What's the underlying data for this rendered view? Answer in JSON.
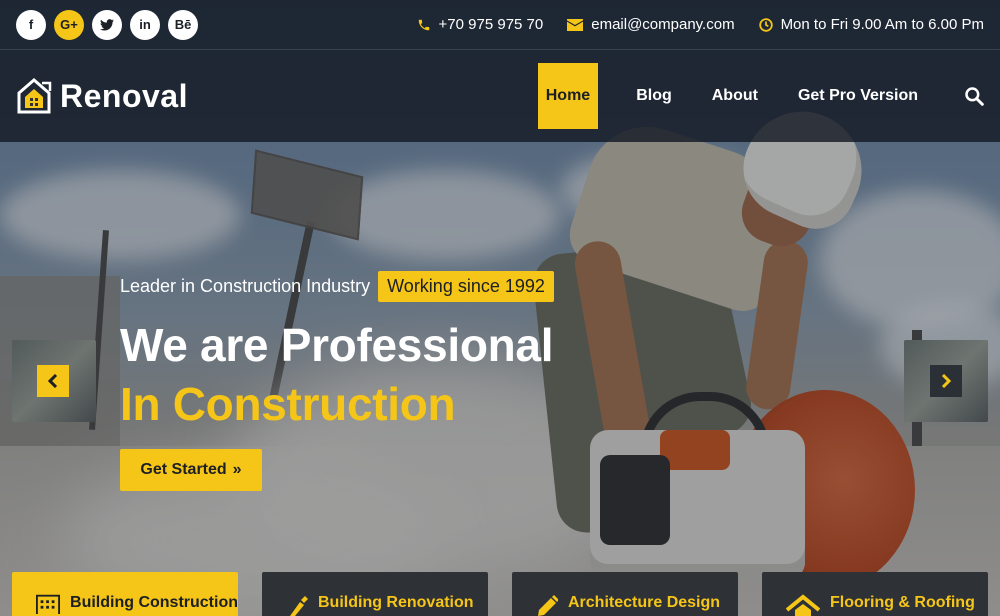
{
  "topbar": {
    "socials": [
      {
        "icon": "facebook-icon",
        "glyph": "f"
      },
      {
        "icon": "google-plus-icon",
        "glyph": "G+"
      },
      {
        "icon": "twitter-icon",
        "glyph": "t"
      },
      {
        "icon": "linkedin-icon",
        "glyph": "in"
      },
      {
        "icon": "behance-icon",
        "glyph": "Bē"
      }
    ],
    "phone": "+70 975 975 70",
    "email": "email@company.com",
    "hours": "Mon to Fri 9.00 Am to 6.00 Pm"
  },
  "nav": {
    "logo_text": "Renoval",
    "items": [
      "Home",
      "Blog",
      "About",
      "Get Pro Version"
    ],
    "active_index": 0
  },
  "hero": {
    "tagline": "Leader in Construction Industry",
    "badge": "Working since 1992",
    "heading_line1": "We are Professional",
    "heading_line2": "In Construction",
    "cta": "Get Started",
    "cta_icon": "»"
  },
  "services": [
    {
      "label": "Building Construction",
      "icon": "building-icon",
      "active": true
    },
    {
      "label": "Building Renovation",
      "icon": "brush-icon",
      "active": false
    },
    {
      "label": "Architecture Design",
      "icon": "pencil-icon",
      "active": false
    },
    {
      "label": "Flooring & Roofing",
      "icon": "roof-icon",
      "active": false
    }
  ],
  "colors": {
    "accent": "#f5c518",
    "dark": "#1c1f24",
    "panel": "#2e3136"
  }
}
